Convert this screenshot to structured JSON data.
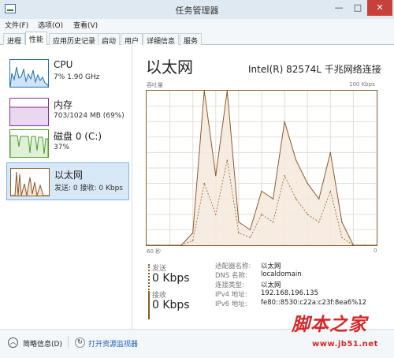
{
  "window": {
    "title": "任务管理器",
    "minimize_label": "—",
    "maximize_label": "□",
    "close_label": "✕"
  },
  "menu": [
    "文件(F)",
    "选项(O)",
    "查看(V)"
  ],
  "tabs": [
    {
      "label": "进程",
      "active": false
    },
    {
      "label": "性能",
      "active": true
    },
    {
      "label": "应用历史记录",
      "active": false
    },
    {
      "label": "启动",
      "active": false
    },
    {
      "label": "用户",
      "active": false
    },
    {
      "label": "详细信息",
      "active": false
    },
    {
      "label": "服务",
      "active": false
    }
  ],
  "sidebar": {
    "items": [
      {
        "name": "CPU",
        "sub": "7% 1.90 GHz",
        "color": "#1f6fb5",
        "fill": "#cfe5f7"
      },
      {
        "name": "内存",
        "sub": "703/1024 MB (69%)",
        "color": "#8b2a9b",
        "fill": "#e9d8ef"
      },
      {
        "name": "磁盘 0 (C:)",
        "sub": "37%",
        "color": "#4c9a2a",
        "fill": "#e0f0d8"
      },
      {
        "name": "以太网",
        "sub": "发送: 0 接收: 0 Kbps",
        "color": "#8b5a2b",
        "fill": "#f2e4d6",
        "selected": true
      }
    ]
  },
  "detail": {
    "title": "以太网",
    "adapter": "Intel(R) 82574L 千兆网络连接",
    "graph_label": "吞吐量",
    "max_label": "100 Kbps",
    "x_left": "60 秒",
    "x_right": "0",
    "send_label": "发送",
    "send_value": "0 Kbps",
    "recv_label": "接收",
    "recv_value": "0 Kbps",
    "properties": [
      {
        "key": "适配器名称:",
        "value": "以太网"
      },
      {
        "key": "DNS 名称:",
        "value": "localdomain"
      },
      {
        "key": "连接类型:",
        "value": "以太网"
      },
      {
        "key": "IPv4 地址:",
        "value": "192.168.196.135"
      },
      {
        "key": "IPv6 地址:",
        "value": "fe80::8530:c22a:c23f:8ea6%12"
      }
    ]
  },
  "chart_data": {
    "type": "line",
    "ylim": [
      0,
      100
    ],
    "x": [
      60,
      57,
      54,
      51,
      48,
      45,
      42,
      39,
      36,
      33,
      30,
      27,
      24,
      21,
      18,
      15,
      12,
      9,
      6,
      3,
      0
    ],
    "series": [
      {
        "values": [
          0,
          0,
          0,
          0,
          8,
          100,
          45,
          100,
          15,
          10,
          35,
          30,
          80,
          55,
          40,
          30,
          60,
          15,
          0,
          0,
          0
        ]
      },
      {
        "values": [
          0,
          0,
          0,
          0,
          3,
          40,
          20,
          55,
          8,
          5,
          20,
          15,
          45,
          30,
          20,
          15,
          35,
          5,
          0,
          0,
          0
        ]
      }
    ],
    "grid": true,
    "xlabel": "",
    "ylabel": ""
  },
  "status": {
    "summary_label": "简略信息(D)",
    "monitor_label": "打开资源监视器",
    "summary_icon": "chevron-up-icon",
    "monitor_icon": "resource-monitor-icon"
  },
  "watermark": {
    "main": "脚本之家",
    "sub": "www.jb51.net"
  },
  "colors": {
    "accent": "#8b5a2b",
    "close": "#c7413a",
    "link": "#1a5fb4",
    "watermark": "#d62828"
  }
}
